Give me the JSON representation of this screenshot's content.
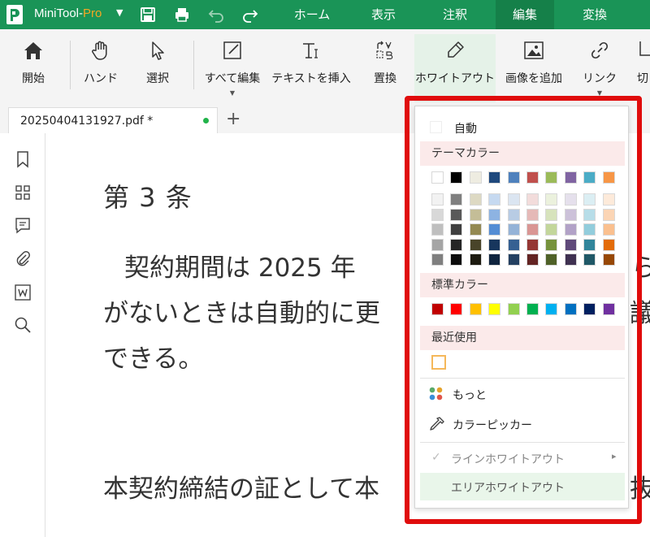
{
  "app": {
    "name_main": "MiniTool-",
    "name_accent": "Pro",
    "dropdown_arrow": "▼"
  },
  "menu": {
    "tabs": [
      "ホーム",
      "表示",
      "注釈",
      "編集",
      "変換"
    ],
    "active": 3
  },
  "ribbon": {
    "buttons": [
      {
        "label": "開始",
        "icon": "home-icon"
      },
      {
        "label": "ハンド",
        "icon": "hand-icon"
      },
      {
        "label": "選択",
        "icon": "cursor-icon"
      },
      {
        "label": "すべて編集",
        "icon": "edit-all-icon"
      },
      {
        "label": "テキストを挿入",
        "icon": "text-insert-icon"
      },
      {
        "label": "置換",
        "icon": "replace-icon"
      },
      {
        "label": "ホワイトアウト",
        "icon": "whiteout-icon"
      },
      {
        "label": "画像を追加",
        "icon": "image-icon"
      },
      {
        "label": "リンク",
        "icon": "link-icon"
      },
      {
        "label": "切",
        "icon": "crop-icon"
      }
    ],
    "active": 6
  },
  "tabs": {
    "document_tab": "20250404131927.pdf *",
    "add_symbol": "+"
  },
  "document": {
    "heading": "第 3 条",
    "line1": "契約期間は 2025 年",
    "line1_right": "ら",
    "line2": "がないときは自動的に更",
    "line2_right": "議",
    "line3": "できる。",
    "line4": "本契約締結の証として本",
    "line4_right": "抜"
  },
  "dropdown": {
    "auto_label": "自動",
    "theme_label": "テーマカラー",
    "standard_label": "標準カラー",
    "recent_label": "最近使用",
    "more_label": "もっと",
    "picker_label": "カラーピッカー",
    "line_whiteout": "ラインホワイトアウト",
    "area_whiteout": "エリアホワイトアウト",
    "submenu_arrow": "▸",
    "check_mark": "✓",
    "theme_top": [
      "#ffffff",
      "#000000",
      "#eeece1",
      "#1f497d",
      "#4f81bd",
      "#c0504d",
      "#9bbb59",
      "#8064a2",
      "#4bacc6",
      "#f79646"
    ],
    "theme_shades": [
      [
        "#f2f2f2",
        "#7f7f7f",
        "#ddd9c3",
        "#c6d9f0",
        "#dbe5f1",
        "#f2dcdb",
        "#ebf1dd",
        "#e5e0ec",
        "#dbeef3",
        "#fdeada"
      ],
      [
        "#d8d8d8",
        "#595959",
        "#c4bd97",
        "#8db3e2",
        "#b8cce4",
        "#e5b9b7",
        "#d7e3bc",
        "#ccc1d9",
        "#b7dde8",
        "#fbd5b5"
      ],
      [
        "#bfbfbf",
        "#3f3f3f",
        "#938953",
        "#548dd4",
        "#95b3d7",
        "#d99694",
        "#c3d69b",
        "#b2a2c7",
        "#92cddc",
        "#fac08f"
      ],
      [
        "#a5a5a5",
        "#262626",
        "#494429",
        "#17365d",
        "#366092",
        "#953734",
        "#76923c",
        "#5f497a",
        "#31859b",
        "#e36c09"
      ],
      [
        "#7f7f7f",
        "#0c0c0c",
        "#1d1b10",
        "#0f243e",
        "#244061",
        "#632423",
        "#4f6128",
        "#3f3151",
        "#205867",
        "#974806"
      ]
    ],
    "standard_colors": [
      "#c00000",
      "#ff0000",
      "#ffc000",
      "#ffff00",
      "#92d050",
      "#00b050",
      "#00b0f0",
      "#0070c0",
      "#002060",
      "#7030a0"
    ],
    "recent_colors": [
      "#ffffff"
    ],
    "recent_border": "#f5b85a"
  },
  "colors": {
    "brand_green": "#1a9457",
    "active_green": "#158049",
    "highlight_red": "#e00c0c"
  }
}
